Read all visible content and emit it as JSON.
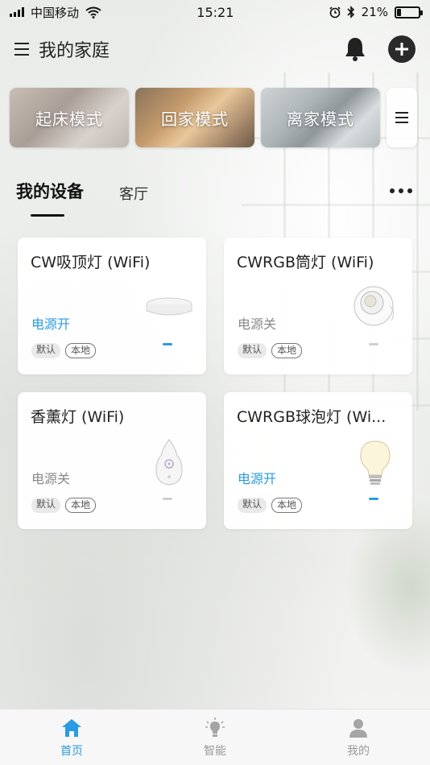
{
  "status_bar": {
    "carrier": "中国移动",
    "time": "15:21",
    "battery_percent": "21%",
    "battery_level": 0.21,
    "icons": [
      "signal-icon",
      "wifi-icon",
      "alarm-icon",
      "bluetooth-icon",
      "battery-icon"
    ]
  },
  "header": {
    "title": "我的家庭",
    "icons": [
      "menu-icon",
      "bell-icon",
      "add-icon"
    ]
  },
  "scenes": [
    {
      "label": "起床模式"
    },
    {
      "label": "回家模式"
    },
    {
      "label": "离家模式"
    }
  ],
  "tabs": {
    "mine": "我的设备",
    "living_room": "客厅"
  },
  "devices": [
    {
      "name": "CW吸顶灯 (WiFi)",
      "status": "电源开",
      "power_on": true,
      "tag_default": "默认",
      "tag_local": "本地",
      "icon": "ceiling-light-icon"
    },
    {
      "name": "CWRGB筒灯 (WiFi)",
      "status": "电源关",
      "power_on": false,
      "tag_default": "默认",
      "tag_local": "本地",
      "icon": "downlight-icon"
    },
    {
      "name": "香薰灯 (WiFi)",
      "status": "电源关",
      "power_on": false,
      "tag_default": "默认",
      "tag_local": "本地",
      "icon": "aroma-lamp-icon"
    },
    {
      "name": "CWRGB球泡灯 (Wi...",
      "status": "电源开",
      "power_on": true,
      "tag_default": "默认",
      "tag_local": "本地",
      "icon": "bulb-icon"
    }
  ],
  "bottom_nav": [
    {
      "label": "首页",
      "icon": "home-icon",
      "active": true
    },
    {
      "label": "智能",
      "icon": "smart-icon",
      "active": false
    },
    {
      "label": "我的",
      "icon": "profile-icon",
      "active": false
    }
  ],
  "colors": {
    "accent": "#2a9be0",
    "text": "#222222",
    "muted": "#888888"
  }
}
